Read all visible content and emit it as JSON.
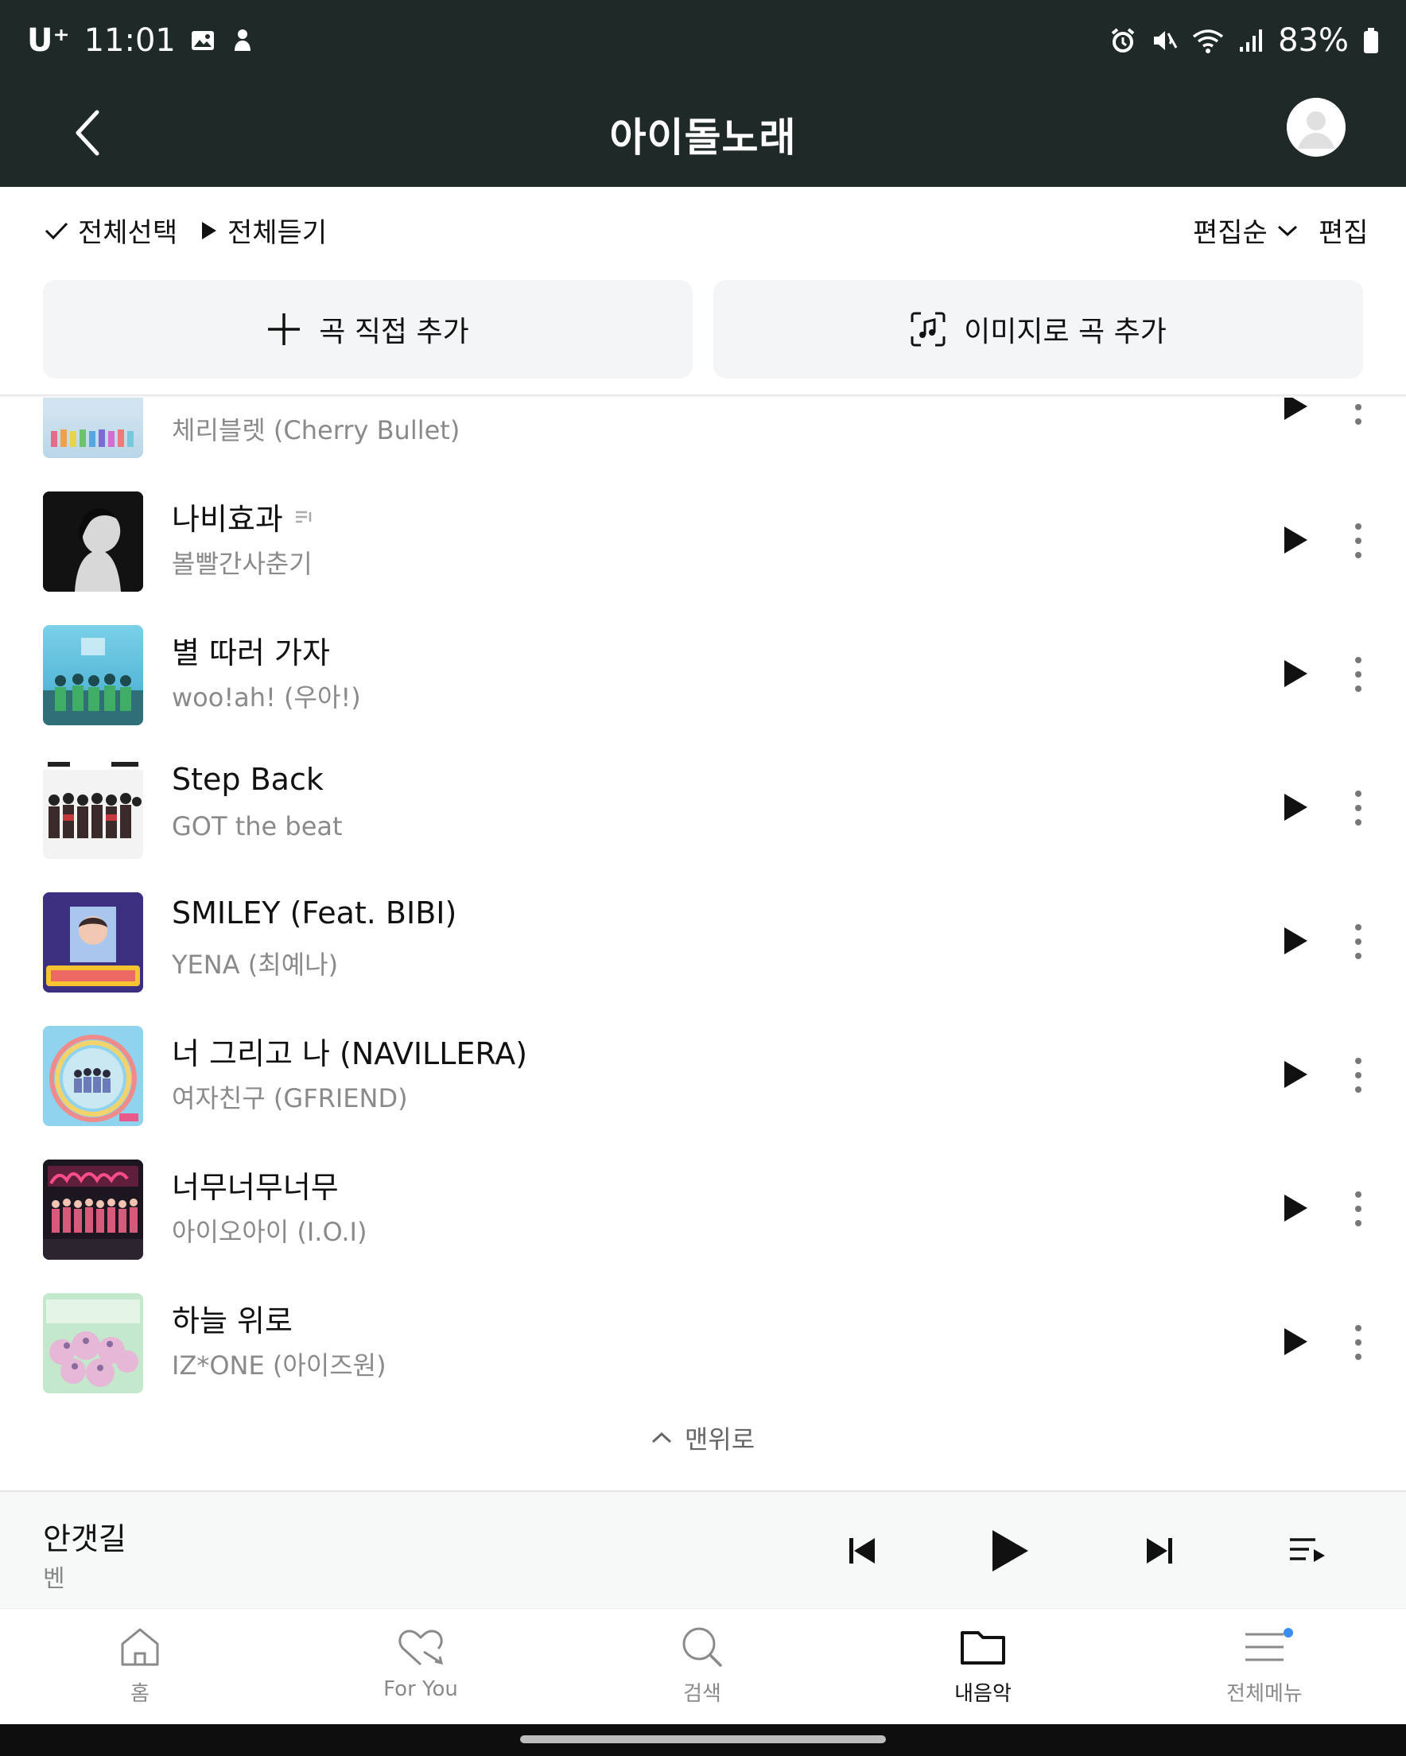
{
  "status_bar": {
    "carrier": "U⁺",
    "time": "11:01",
    "battery": "83%"
  },
  "header": {
    "title": "아이돌노래"
  },
  "toolbar": {
    "select_all": "전체선택",
    "play_all": "전체듣기",
    "sort": "편집순",
    "edit": "편집"
  },
  "add_buttons": {
    "direct": "곡 직접 추가",
    "by_image": "이미지로 곡 추가"
  },
  "songs": [
    {
      "title": "",
      "artist": "체리블렛 (Cherry Bullet)"
    },
    {
      "title": "나비효과",
      "artist": "볼빨간사춘기"
    },
    {
      "title": "별 따러 가자",
      "artist": "woo!ah! (우아!)"
    },
    {
      "title": "Step Back",
      "artist": "GOT the beat"
    },
    {
      "title": "SMILEY (Feat. BIBI)",
      "artist": "YENA (최예나)"
    },
    {
      "title": "너 그리고 나 (NAVILLERA)",
      "artist": "여자친구 (GFRIEND)"
    },
    {
      "title": "너무너무너무",
      "artist": "아이오아이 (I.O.I)"
    },
    {
      "title": "하늘 위로",
      "artist": "IZ*ONE (아이즈원)"
    }
  ],
  "to_top": "맨위로",
  "now_playing": {
    "title": "안갯길",
    "artist": "벤"
  },
  "bottom_nav": {
    "home": "홈",
    "for_you": "For You",
    "search": "검색",
    "my_music": "내음악",
    "menu": "전체메뉴"
  },
  "colors": {
    "header_bg": "#1f2a28",
    "accent_dot": "#3a8df0",
    "secondary_text": "#8a8a8a"
  }
}
